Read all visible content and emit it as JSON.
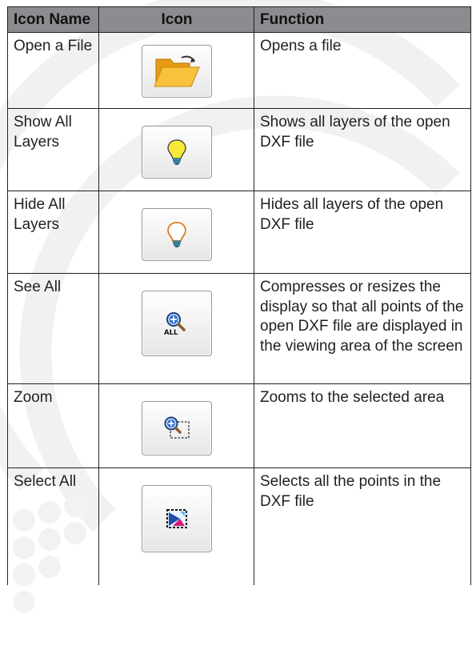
{
  "table": {
    "headers": {
      "name": "Icon Name",
      "icon": "Icon",
      "function": "Function"
    },
    "rows": [
      {
        "name": "Open a File",
        "icon": "open-folder-icon",
        "function": "Opens a file"
      },
      {
        "name": "Show All Layers",
        "icon": "lit-bulb-icon",
        "function": "Shows all layers of the open DXF file"
      },
      {
        "name": "Hide All Layers",
        "icon": "unlit-bulb-icon",
        "function": "Hides all layers of the open DXF file"
      },
      {
        "name": "See All",
        "icon": "zoom-all-icon",
        "icon_text": "ALL",
        "function": "Compresses or resizes the display so that all points of the open DXF file are displayed in the viewing area of the screen"
      },
      {
        "name": "Zoom",
        "icon": "zoom-selection-icon",
        "function": "Zooms to the selected area"
      },
      {
        "name": "Select All",
        "icon": "select-all-icon",
        "function": "Selects all the points in the DXF file"
      }
    ]
  },
  "colors": {
    "header_bg": "#8a8c8f",
    "rule": "#231f20",
    "folder": "#f5b11f",
    "bulb_lit": "#f7e93a",
    "bulb_outline": "#e07a1a",
    "magnifier": "#2e6fd1"
  }
}
